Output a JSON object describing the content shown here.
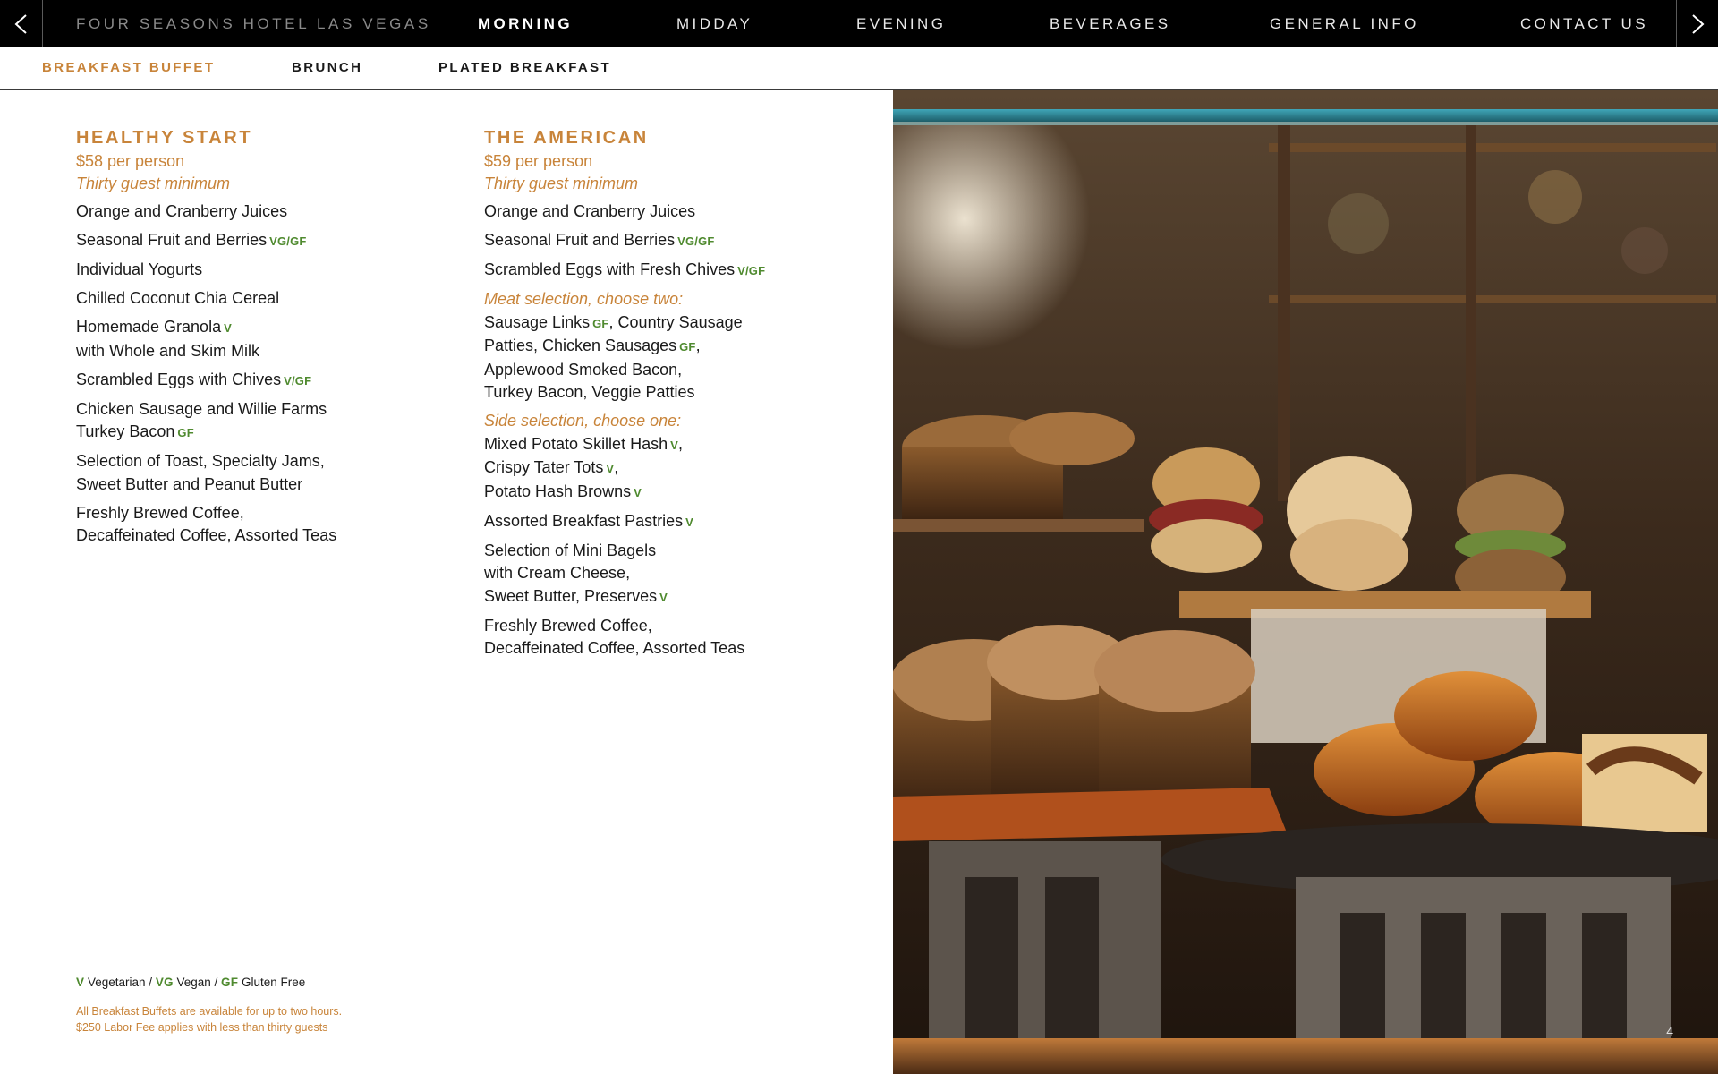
{
  "nav": {
    "brand": "FOUR SEASONS HOTEL LAS VEGAS",
    "items": [
      {
        "label": "MORNING",
        "active": true
      },
      {
        "label": "MIDDAY",
        "active": false
      },
      {
        "label": "EVENING",
        "active": false
      },
      {
        "label": "BEVERAGES",
        "active": false
      },
      {
        "label": "GENERAL INFO",
        "active": false
      },
      {
        "label": "CONTACT US",
        "active": false
      }
    ],
    "prev_icon": "chevron-left-icon",
    "next_icon": "chevron-right-icon"
  },
  "subnav": {
    "items": [
      {
        "label": "BREAKFAST BUFFET",
        "active": true
      },
      {
        "label": "BRUNCH",
        "active": false
      },
      {
        "label": "PLATED BREAKFAST",
        "active": false
      }
    ]
  },
  "menus": {
    "healthy": {
      "title": "HEALTHY START",
      "price": "$58 per person",
      "minimum": "Thirty guest minimum",
      "items": {
        "i1": "Orange and Cranberry Juices",
        "i2": "Seasonal Fruit and Berries",
        "i2_tag": "VG/GF",
        "i3": "Individual Yogurts",
        "i4": "Chilled Coconut Chia Cereal",
        "i5a": "Homemade Granola",
        "i5_tag": "V",
        "i5b": "with Whole and Skim Milk",
        "i6": "Scrambled Eggs with Chives",
        "i6_tag": "V/GF",
        "i7a": "Chicken Sausage and Willie Farms",
        "i7b": "Turkey Bacon",
        "i7_tag": "GF",
        "i8a": "Selection of Toast, Specialty Jams,",
        "i8b": "Sweet Butter and Peanut Butter",
        "i9a": "Freshly Brewed Coffee,",
        "i9b": "Decaffeinated Coffee, Assorted Teas"
      }
    },
    "american": {
      "title": "THE AMERICAN",
      "price": "$59 per person",
      "minimum": "Thirty guest minimum",
      "items": {
        "i1": "Orange and Cranberry Juices",
        "i2": "Seasonal Fruit and Berries",
        "i2_tag": "VG/GF",
        "i3": "Scrambled Eggs with Fresh Chives",
        "i3_tag": "V/GF",
        "meat_heading": "Meat selection, choose two:",
        "m1a": "Sausage Links",
        "m1_tag": "GF",
        "m1b": ", Country Sausage",
        "m2a": "Patties, Chicken Sausages",
        "m2_tag": "GF",
        "m2b": ",",
        "m3": "Applewood Smoked Bacon,",
        "m4": "Turkey Bacon, Veggie Patties",
        "side_heading": "Side selection, choose one:",
        "s1": "Mixed Potato Skillet Hash",
        "s1_tag": "V",
        "s1b": ",",
        "s2": "Crispy Tater Tots",
        "s2_tag": "V",
        "s2b": ",",
        "s3": "Potato Hash Browns",
        "s3_tag": "V",
        "i4": "Assorted Breakfast Pastries",
        "i4_tag": "V",
        "i5a": "Selection of Mini Bagels",
        "i5b": "with Cream Cheese,",
        "i5c": "Sweet Butter, Preserves",
        "i5_tag": "V",
        "i6a": "Freshly Brewed Coffee,",
        "i6b": "Decaffeinated Coffee, Assorted Teas"
      }
    }
  },
  "legend": {
    "v": "V",
    "v_text": "Vegetarian /",
    "vg": "VG",
    "vg_text": "Vegan /",
    "gf": "GF",
    "gf_text": "Gluten Free"
  },
  "footnotes": {
    "line1": "All Breakfast Buffets are available for up to two hours.",
    "line2": "$250 Labor Fee applies with less than thirty guests"
  },
  "page_number": "4",
  "colors": {
    "accent": "#c8843a",
    "diet_tag": "#4f8a2f",
    "nav_bg": "#000000"
  }
}
